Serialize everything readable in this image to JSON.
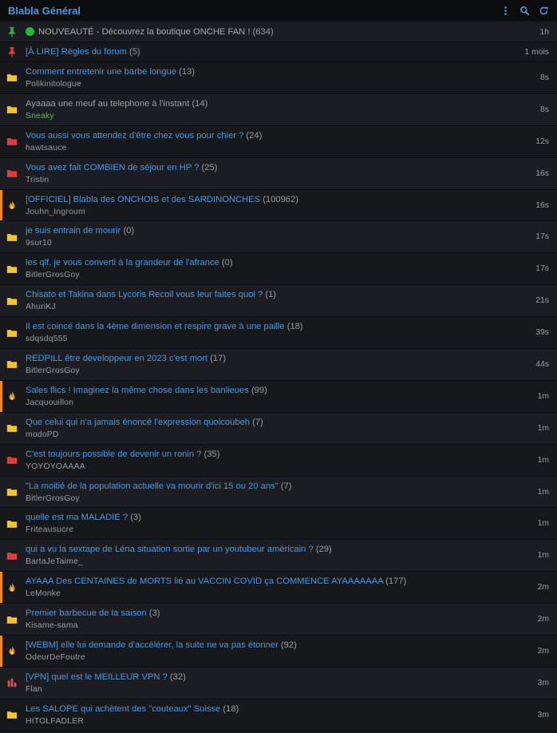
{
  "header": {
    "title": "Blabla Général",
    "icons": [
      "more-vertical-icon",
      "search-icon",
      "refresh-icon"
    ]
  },
  "colors": {
    "link": "#4b98e0",
    "hot": "#ef8a17",
    "folder": "#f4c430",
    "folder_red": "#e23b3b",
    "pin_green": "#37a84a",
    "pin_red": "#e23b3b",
    "online": "#22bb33"
  },
  "pinned": [
    {
      "icon": "pin-green-icon",
      "online": true,
      "title": "NOUVEAUTÉ - Découvrez la boutique ONCHE FAN !",
      "count": "(634)",
      "time": "1h"
    },
    {
      "icon": "pin-red-icon",
      "online": false,
      "title": "[À LIRE] Règles du forum",
      "count": "(5)",
      "time": "1 mois"
    }
  ],
  "topics": [
    {
      "icon": "folder-yellow-icon",
      "title": "Comment entretenir une barbe longue",
      "count": "(13)",
      "author": "Polikinitologue",
      "time": "8s"
    },
    {
      "icon": "folder-yellow-icon",
      "visited": true,
      "title": "Ayaaaa une meuf au telephone à l'instant",
      "count": "(14)",
      "author": "Sneaky",
      "author_green": true,
      "time": "8s"
    },
    {
      "icon": "folder-red-icon",
      "title": "Vous aussi vous attendez d'être chez vous pour chier ?",
      "count": "(24)",
      "author": "hawtsauce",
      "time": "12s"
    },
    {
      "icon": "folder-red-icon",
      "title": "Vous avez fait COMBIEN de séjour en HP ?",
      "count": "(25)",
      "author": "Tristin",
      "time": "16s"
    },
    {
      "icon": "fire-icon",
      "hot": true,
      "title": "[OFFICIEL] Blabla des ONCHOIS et des SARDINONCHES",
      "count": "(100962)",
      "author": "Jouhn_Ingroum",
      "time": "16s"
    },
    {
      "icon": "folder-yellow-icon",
      "title": "je suis entrain de mourir",
      "count": "(0)",
      "author": "9sur10",
      "time": "17s"
    },
    {
      "icon": "folder-yellow-icon",
      "title": "les qlf, je vous converti à la grandeur de l'afrance",
      "count": "(0)",
      "author": "BitlerGrosGoy",
      "time": "17s"
    },
    {
      "icon": "folder-yellow-icon",
      "title": "Chisato et Takina dans Lycoris Recoil vous leur faites quoi ?",
      "count": "(1)",
      "author": "AhuriKJ",
      "time": "21s"
    },
    {
      "icon": "folder-yellow-icon",
      "title": "Il est coincé dans la 4ème dimension et respire grave à une paille",
      "count": "(18)",
      "author": "sdqsdq555",
      "time": "39s"
    },
    {
      "icon": "folder-yellow-icon",
      "title": "REDPILL être developpeur en 2023 c'est mort",
      "count": "(17)",
      "author": "BitlerGrosGoy",
      "time": "44s"
    },
    {
      "icon": "fire-icon",
      "hot": true,
      "title": "Sales flics ! Imaginez la même chose dans les banlieues",
      "count": "(99)",
      "author": "Jacquouillon",
      "time": "1m"
    },
    {
      "icon": "folder-yellow-icon",
      "title": "Que celui qui n'a jamais énoncé l'expression quoicoubeh",
      "count": "(7)",
      "author": "modoPD",
      "time": "1m"
    },
    {
      "icon": "folder-red-icon",
      "title": "C'est toujours possible de devenir un ronin ?",
      "count": "(35)",
      "author": "YOYOYOAAAA",
      "time": "1m"
    },
    {
      "icon": "folder-yellow-icon",
      "title": "\"La moitié de la population actuelle va mourir d'ici 15 ou 20 ans\"",
      "count": "(7)",
      "author": "BitlerGrosGoy",
      "time": "1m"
    },
    {
      "icon": "folder-yellow-icon",
      "title": "quelle est ma MALADIE ?",
      "count": "(3)",
      "author": "Friteausucre",
      "time": "1m"
    },
    {
      "icon": "folder-red-icon",
      "title": "qui a vu la sextape de Léna situation sortie par un youtubeur américain ?",
      "count": "(29)",
      "author": "BartaJeTaime_",
      "time": "1m"
    },
    {
      "icon": "fire-icon",
      "hot": true,
      "title": "AYAAA Des CENTAINES de MORTS lié au VACCIN COVID ça COMMENCE AYAAAAAAA",
      "count": "(177)",
      "author": "LeMonke",
      "time": "2m"
    },
    {
      "icon": "folder-yellow-icon",
      "title": "Premier barbecue de la saison",
      "count": "(3)",
      "author": "Kisame-sama",
      "time": "2m"
    },
    {
      "icon": "fire-icon",
      "hot": true,
      "title": "[WEBM] elle lui demande d'accélérer, la suite ne va pas étonner",
      "count": "(92)",
      "author": "OdeurDeFoutre",
      "time": "2m"
    },
    {
      "icon": "poll-icon",
      "title": "[VPN] quel est le MEILLEUR VPN ?",
      "count": "(32)",
      "author": "Flan",
      "time": "3m"
    },
    {
      "icon": "folder-yellow-icon",
      "title": "Les SALOPE qui achètent des \"couteaux\" Suisse",
      "count": "(18)",
      "author": "HITOLFADLER",
      "time": "3m"
    }
  ]
}
